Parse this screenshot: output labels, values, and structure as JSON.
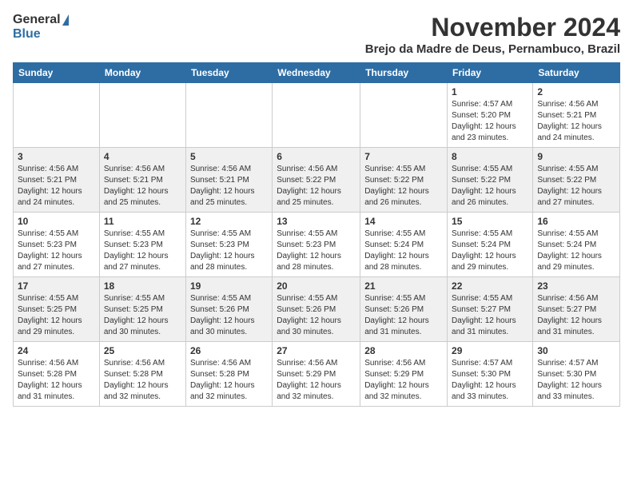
{
  "logo": {
    "general": "General",
    "blue": "Blue"
  },
  "header": {
    "month": "November 2024",
    "location": "Brejo da Madre de Deus, Pernambuco, Brazil"
  },
  "weekdays": [
    "Sunday",
    "Monday",
    "Tuesday",
    "Wednesday",
    "Thursday",
    "Friday",
    "Saturday"
  ],
  "weeks": [
    [
      {
        "day": "",
        "info": ""
      },
      {
        "day": "",
        "info": ""
      },
      {
        "day": "",
        "info": ""
      },
      {
        "day": "",
        "info": ""
      },
      {
        "day": "",
        "info": ""
      },
      {
        "day": "1",
        "info": "Sunrise: 4:57 AM\nSunset: 5:20 PM\nDaylight: 12 hours and 23 minutes."
      },
      {
        "day": "2",
        "info": "Sunrise: 4:56 AM\nSunset: 5:21 PM\nDaylight: 12 hours and 24 minutes."
      }
    ],
    [
      {
        "day": "3",
        "info": "Sunrise: 4:56 AM\nSunset: 5:21 PM\nDaylight: 12 hours and 24 minutes."
      },
      {
        "day": "4",
        "info": "Sunrise: 4:56 AM\nSunset: 5:21 PM\nDaylight: 12 hours and 25 minutes."
      },
      {
        "day": "5",
        "info": "Sunrise: 4:56 AM\nSunset: 5:21 PM\nDaylight: 12 hours and 25 minutes."
      },
      {
        "day": "6",
        "info": "Sunrise: 4:56 AM\nSunset: 5:22 PM\nDaylight: 12 hours and 25 minutes."
      },
      {
        "day": "7",
        "info": "Sunrise: 4:55 AM\nSunset: 5:22 PM\nDaylight: 12 hours and 26 minutes."
      },
      {
        "day": "8",
        "info": "Sunrise: 4:55 AM\nSunset: 5:22 PM\nDaylight: 12 hours and 26 minutes."
      },
      {
        "day": "9",
        "info": "Sunrise: 4:55 AM\nSunset: 5:22 PM\nDaylight: 12 hours and 27 minutes."
      }
    ],
    [
      {
        "day": "10",
        "info": "Sunrise: 4:55 AM\nSunset: 5:23 PM\nDaylight: 12 hours and 27 minutes."
      },
      {
        "day": "11",
        "info": "Sunrise: 4:55 AM\nSunset: 5:23 PM\nDaylight: 12 hours and 27 minutes."
      },
      {
        "day": "12",
        "info": "Sunrise: 4:55 AM\nSunset: 5:23 PM\nDaylight: 12 hours and 28 minutes."
      },
      {
        "day": "13",
        "info": "Sunrise: 4:55 AM\nSunset: 5:23 PM\nDaylight: 12 hours and 28 minutes."
      },
      {
        "day": "14",
        "info": "Sunrise: 4:55 AM\nSunset: 5:24 PM\nDaylight: 12 hours and 28 minutes."
      },
      {
        "day": "15",
        "info": "Sunrise: 4:55 AM\nSunset: 5:24 PM\nDaylight: 12 hours and 29 minutes."
      },
      {
        "day": "16",
        "info": "Sunrise: 4:55 AM\nSunset: 5:24 PM\nDaylight: 12 hours and 29 minutes."
      }
    ],
    [
      {
        "day": "17",
        "info": "Sunrise: 4:55 AM\nSunset: 5:25 PM\nDaylight: 12 hours and 29 minutes."
      },
      {
        "day": "18",
        "info": "Sunrise: 4:55 AM\nSunset: 5:25 PM\nDaylight: 12 hours and 30 minutes."
      },
      {
        "day": "19",
        "info": "Sunrise: 4:55 AM\nSunset: 5:26 PM\nDaylight: 12 hours and 30 minutes."
      },
      {
        "day": "20",
        "info": "Sunrise: 4:55 AM\nSunset: 5:26 PM\nDaylight: 12 hours and 30 minutes."
      },
      {
        "day": "21",
        "info": "Sunrise: 4:55 AM\nSunset: 5:26 PM\nDaylight: 12 hours and 31 minutes."
      },
      {
        "day": "22",
        "info": "Sunrise: 4:55 AM\nSunset: 5:27 PM\nDaylight: 12 hours and 31 minutes."
      },
      {
        "day": "23",
        "info": "Sunrise: 4:56 AM\nSunset: 5:27 PM\nDaylight: 12 hours and 31 minutes."
      }
    ],
    [
      {
        "day": "24",
        "info": "Sunrise: 4:56 AM\nSunset: 5:28 PM\nDaylight: 12 hours and 31 minutes."
      },
      {
        "day": "25",
        "info": "Sunrise: 4:56 AM\nSunset: 5:28 PM\nDaylight: 12 hours and 32 minutes."
      },
      {
        "day": "26",
        "info": "Sunrise: 4:56 AM\nSunset: 5:28 PM\nDaylight: 12 hours and 32 minutes."
      },
      {
        "day": "27",
        "info": "Sunrise: 4:56 AM\nSunset: 5:29 PM\nDaylight: 12 hours and 32 minutes."
      },
      {
        "day": "28",
        "info": "Sunrise: 4:56 AM\nSunset: 5:29 PM\nDaylight: 12 hours and 32 minutes."
      },
      {
        "day": "29",
        "info": "Sunrise: 4:57 AM\nSunset: 5:30 PM\nDaylight: 12 hours and 33 minutes."
      },
      {
        "day": "30",
        "info": "Sunrise: 4:57 AM\nSunset: 5:30 PM\nDaylight: 12 hours and 33 minutes."
      }
    ]
  ]
}
